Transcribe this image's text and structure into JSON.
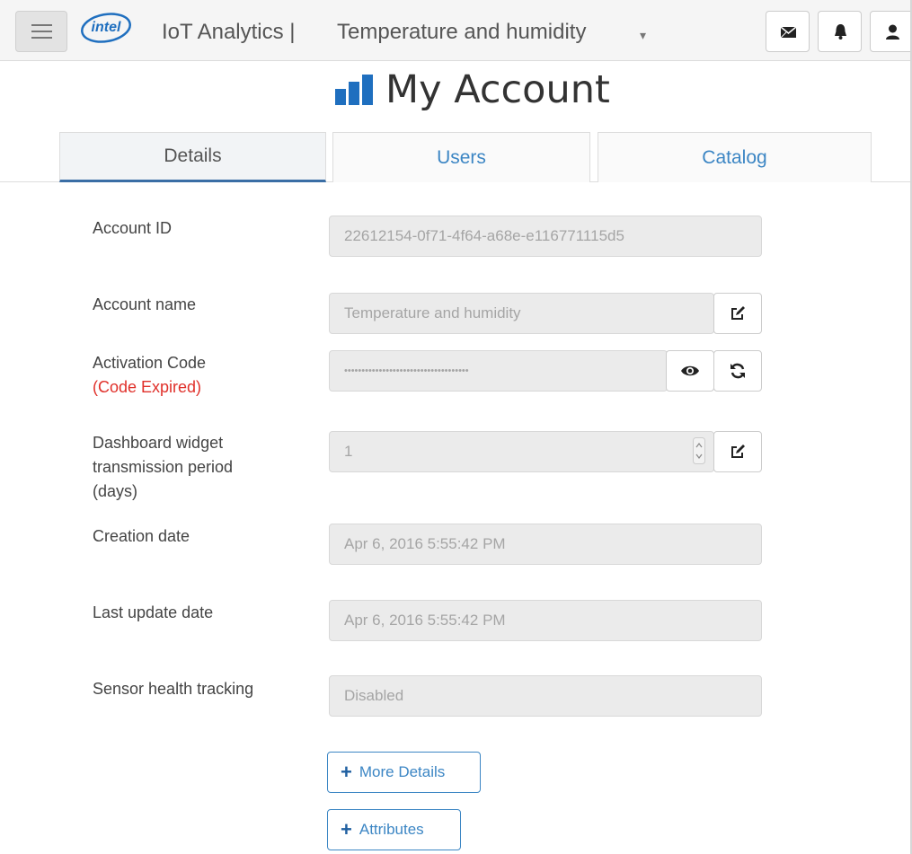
{
  "header": {
    "brand": "intel",
    "app_title": "IoT Analytics |",
    "account_selected": "Temperature and humidity",
    "icons": [
      "menu-icon",
      "mail-icon",
      "bell-icon",
      "user-icon"
    ]
  },
  "page": {
    "title": "My Account",
    "title_icon": "bar-chart-icon"
  },
  "tabs": [
    {
      "label": "Details",
      "active": true
    },
    {
      "label": "Users",
      "active": false
    },
    {
      "label": "Catalog",
      "active": false
    }
  ],
  "details": {
    "account_id": {
      "label": "Account ID",
      "value": "22612154-0f71-4f64-a68e-e116771115d5"
    },
    "account_name": {
      "label": "Account name",
      "value": "Temperature and humidity"
    },
    "activation_code": {
      "label": "Activation Code",
      "status": "(Code Expired)",
      "value": "••••••••••••••••••••••••••••••••••••"
    },
    "widget_period": {
      "label_line1": "Dashboard widget",
      "label_line2": "transmission period",
      "label_line3": "(days)",
      "value": "1"
    },
    "creation_date": {
      "label": "Creation date",
      "value": "Apr 6, 2016 5:55:42 PM"
    },
    "last_update_date": {
      "label": "Last update date",
      "value": "Apr 6, 2016 5:55:42 PM"
    },
    "sensor_health": {
      "label": "Sensor health tracking",
      "value": "Disabled"
    }
  },
  "buttons": {
    "more_details": "More Details",
    "attributes": "Attributes"
  },
  "colors": {
    "link": "#3c86c4",
    "expired": "#e0302a",
    "brand": "#1f6fbf"
  }
}
